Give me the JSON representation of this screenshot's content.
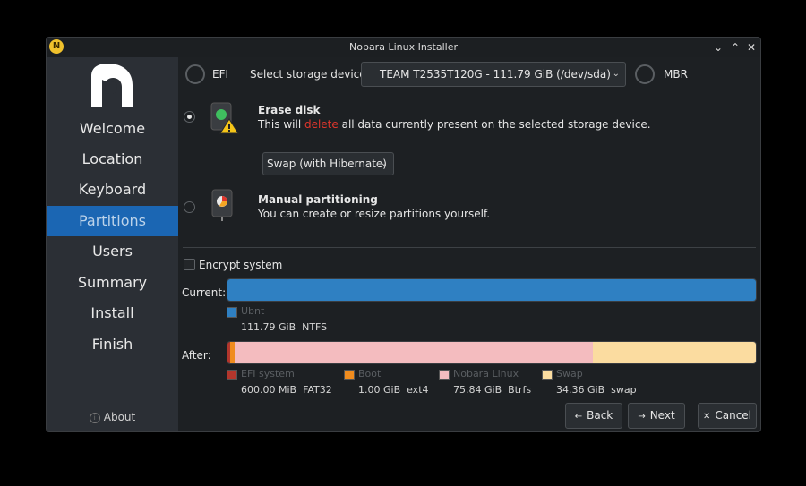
{
  "window": {
    "title": "Nobara Linux Installer"
  },
  "sidebar": {
    "items": [
      {
        "label": "Welcome"
      },
      {
        "label": "Location"
      },
      {
        "label": "Keyboard"
      },
      {
        "label": "Partitions"
      },
      {
        "label": "Users"
      },
      {
        "label": "Summary"
      },
      {
        "label": "Install"
      },
      {
        "label": "Finish"
      }
    ],
    "active": "Partitions",
    "about_label": "About"
  },
  "storage": {
    "efi_label": "EFI",
    "select_label": "Select storage device:",
    "device_value": "TEAM T2535T120G - 111.79 GiB (/dev/sda)",
    "mbr_label": "MBR"
  },
  "erase": {
    "title": "Erase disk",
    "desc_before": "This will ",
    "desc_delete": "delete",
    "desc_after": " all data currently present on the selected storage device.",
    "swap_value": "Swap (with Hibernate)"
  },
  "manual": {
    "title": "Manual partitioning",
    "desc": "You can create or resize partitions yourself."
  },
  "encrypt_label": "Encrypt system",
  "current": {
    "label": "Current:",
    "partitions": [
      {
        "name": "Ubnt",
        "size": "111.79 GiB",
        "fs": "NTFS",
        "color": "#2f80c2",
        "fraction": 1.0
      }
    ]
  },
  "after": {
    "label": "After:",
    "partitions": [
      {
        "name": "EFI system",
        "size": "600.00 MiB",
        "fs": "FAT32",
        "color": "#b2362c",
        "fraction": 0.0052
      },
      {
        "name": "Boot",
        "size": "1.00 GiB",
        "fs": "ext4",
        "color": "#f08c1e",
        "fraction": 0.009
      },
      {
        "name": "Nobara Linux",
        "size": "75.84 GiB",
        "fs": "Btrfs",
        "color": "#f4bcbf",
        "fraction": 0.678
      },
      {
        "name": "Swap",
        "size": "34.36 GiB",
        "fs": "swap",
        "color": "#fbdca0",
        "fraction": 0.307
      }
    ]
  },
  "buttons": {
    "back": "Back",
    "next": "Next",
    "cancel": "Cancel"
  },
  "colors": {
    "accent": "#1b66b3",
    "delete": "#e0362c"
  }
}
